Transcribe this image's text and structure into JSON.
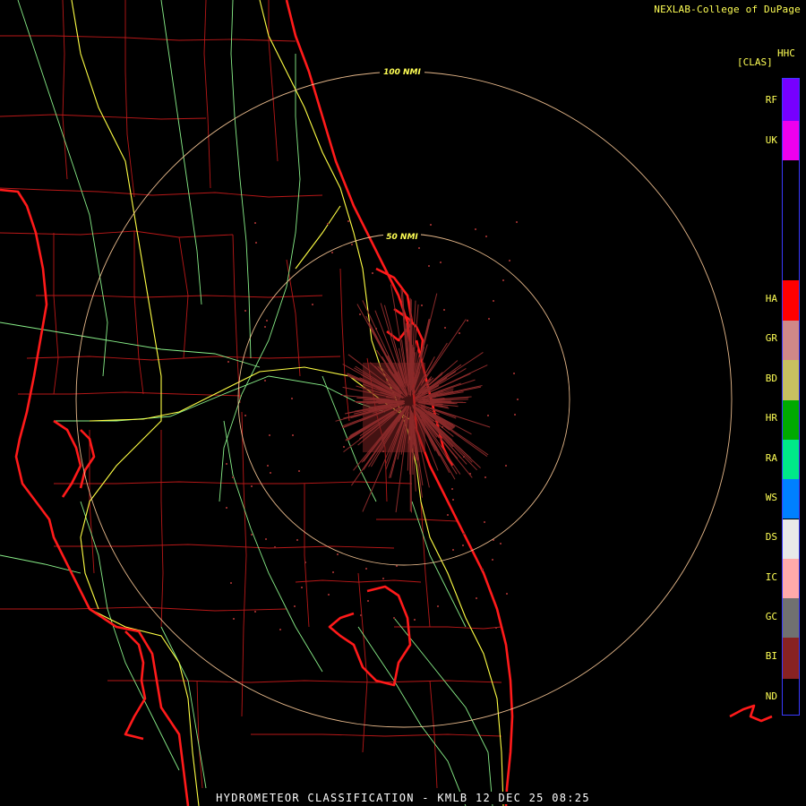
{
  "header": {
    "credit": "NEXLAB-College of DuPage"
  },
  "legend": {
    "product_code": "HHC",
    "product_id": "[CLAS]",
    "classes": [
      {
        "code": "RF",
        "color": "#7700ff"
      },
      {
        "code": "UK",
        "color": "#ee00ee"
      },
      {
        "code": "HA",
        "color": "#ff0000"
      },
      {
        "code": "GR",
        "color": "#d08888"
      },
      {
        "code": "BD",
        "color": "#c8c060"
      },
      {
        "code": "HR",
        "color": "#00aa00"
      },
      {
        "code": "RA",
        "color": "#00e888"
      },
      {
        "code": "WS",
        "color": "#0080ff"
      },
      {
        "code": "DS",
        "color": "#e8e8e8"
      },
      {
        "code": "IC",
        "color": "#ffaaaa"
      },
      {
        "code": "GC",
        "color": "#707070"
      },
      {
        "code": "BI",
        "color": "#882222"
      },
      {
        "code": "ND",
        "color": "#000000"
      }
    ]
  },
  "range_rings": [
    {
      "label": "100 NMI"
    },
    {
      "label": "50 NMI"
    }
  ],
  "footer": {
    "title": "HYDROMETEOR CLASSIFICATION - KMLB 12 DEC 25 08:25"
  },
  "colors": {
    "coast": "#ff1a1a",
    "county": "#cc1a1a",
    "interstate": "#ffff44",
    "highway": "#88ee88",
    "ring": "#ffcc99",
    "echo": "#8a2a2a"
  }
}
